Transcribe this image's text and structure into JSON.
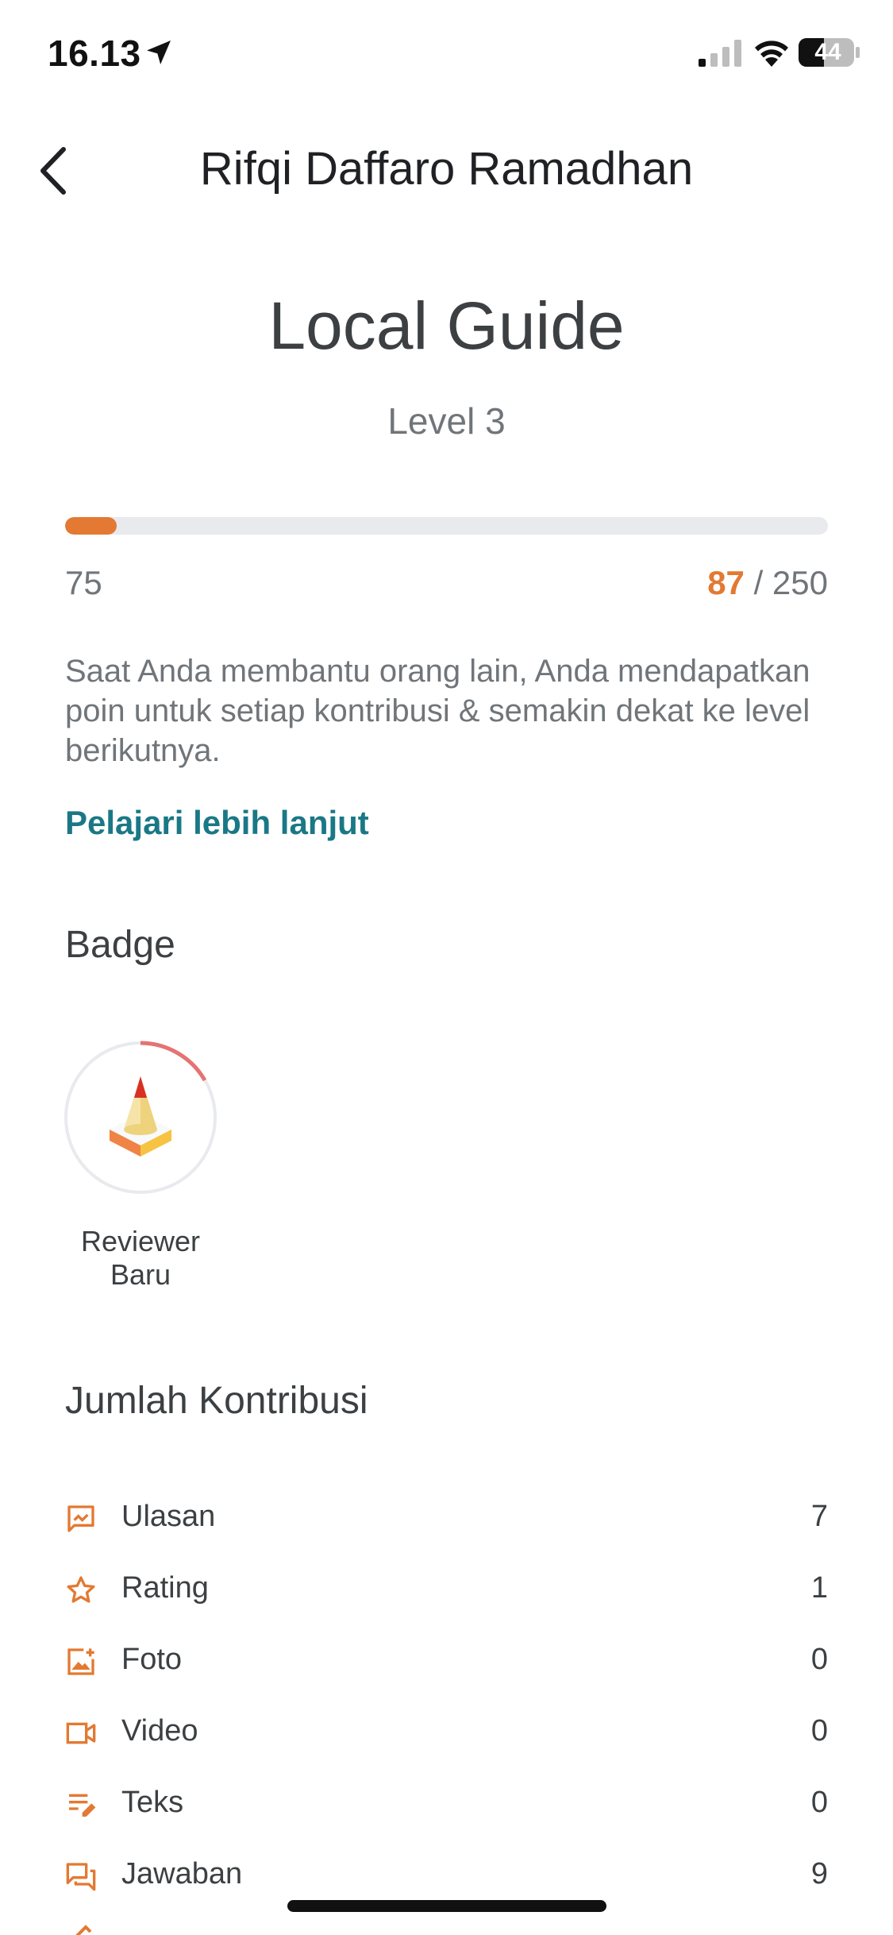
{
  "status_bar": {
    "time": "16.13",
    "battery": "44"
  },
  "header": {
    "title": "Rifqi Daffaro Ramadhan"
  },
  "local_guide": {
    "title": "Local Guide",
    "level": "Level 3",
    "progress_min": "75",
    "progress_current": "87",
    "progress_separator": " / ",
    "progress_max": "250",
    "progress_fraction": 0.068,
    "description": "Saat Anda membantu orang lain, Anda mendapatkan poin untuk setiap kontribusi & semakin dekat ke level berikutnya.",
    "learn_more": "Pelajari lebih lanjut"
  },
  "badge_section": {
    "title": "Badge",
    "badges": [
      {
        "label": "Reviewer Baru"
      }
    ]
  },
  "contributions": {
    "title": "Jumlah Kontribusi",
    "items": [
      {
        "label": "Ulasan",
        "count": "7",
        "icon": "review-icon"
      },
      {
        "label": "Rating",
        "count": "1",
        "icon": "star-icon"
      },
      {
        "label": "Foto",
        "count": "0",
        "icon": "photo-icon"
      },
      {
        "label": "Video",
        "count": "0",
        "icon": "video-icon"
      },
      {
        "label": "Teks",
        "count": "0",
        "icon": "text-edit-icon"
      },
      {
        "label": "Jawaban",
        "count": "9",
        "icon": "answer-icon"
      }
    ]
  },
  "colors": {
    "accent": "#e37932",
    "link": "#1a7886",
    "track": "#e8eaed"
  }
}
